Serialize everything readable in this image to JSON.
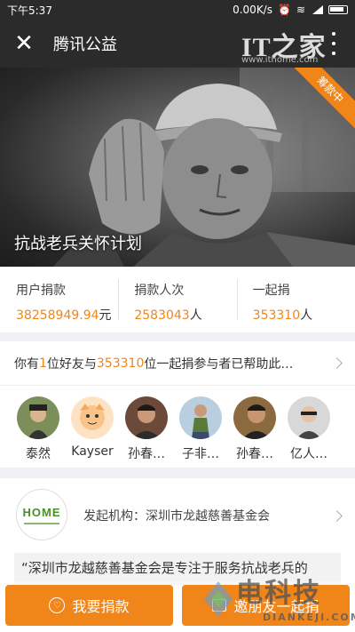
{
  "status_bar": {
    "time": "下午5:37",
    "net_speed": "0.00K/s"
  },
  "header": {
    "title": "腾讯公益",
    "watermark_logo": "IT之家",
    "watermark_url": "www.ithome.com"
  },
  "hero": {
    "title": "抗战老兵关怀计划",
    "ribbon": "筹款中"
  },
  "stats": [
    {
      "label": "用户捐款",
      "value": "38258949.94",
      "unit": "元"
    },
    {
      "label": "捐款人次",
      "value": "2583043",
      "unit": "人"
    },
    {
      "label": "一起捐",
      "value": "353310",
      "unit": "人"
    }
  ],
  "friends": {
    "prefix": "你有 ",
    "friend_count": "1",
    "middle": " 位好友与 ",
    "participant_count": "353310",
    "suffix": " 位一起捐参与者已帮助此…",
    "avatars": [
      {
        "name": "泰然"
      },
      {
        "name": "Kayser"
      },
      {
        "name": "孙春…"
      },
      {
        "name": "子非…"
      },
      {
        "name": "孙春…"
      },
      {
        "name": "亿人…"
      }
    ]
  },
  "organization": {
    "label": "发起机构：深圳市龙越慈善基金会",
    "logo_text": "HOME",
    "description": "“深圳市龙越慈善基金会是专注于服务抗战老兵的"
  },
  "actions": {
    "donate": "我要捐款",
    "invite": "邀朋友一起捐"
  },
  "watermark_brand": {
    "main": "电科技",
    "sub": "DIANKEJI.COM"
  },
  "colors": {
    "accent": "#f08519",
    "title_bar": "#2b2b2b"
  }
}
